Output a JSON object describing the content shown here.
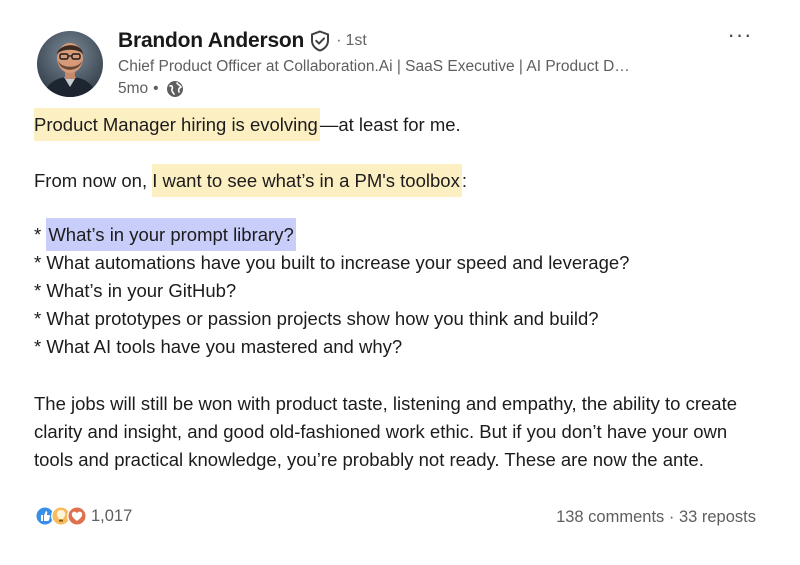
{
  "author": {
    "name": "Brandon Anderson",
    "degree": "1st",
    "headline": "Chief Product Officer at Collaboration.Ai | SaaS Executive | AI Product D…",
    "posted_ago": "5mo",
    "separator": "•"
  },
  "post": {
    "line1_highlight": "Product Manager hiring is evolving",
    "line1_rest": "—at least for me.",
    "line2_prefix": "From now on, ",
    "line2_highlight": "I want to see what’s in a PM's toolbox",
    "line2_suffix": ":",
    "bullets": [
      {
        "star": "* ",
        "text": "What’s in your prompt library?"
      },
      {
        "star": "* ",
        "text": "What automations have you built to increase your speed and leverage?"
      },
      {
        "star": "* ",
        "text": "What’s in your GitHub?"
      },
      {
        "star": "* ",
        "text": "What prototypes or passion projects show how you think and build?"
      },
      {
        "star": "* ",
        "text": "What AI tools have you mastered and why?"
      }
    ],
    "closing": "The jobs will still be won with product taste, listening and empathy, the ability to create clarity and insight, and good old-fashioned work ethic. But if you don’t have your own tools and practical knowledge, you’re probably not ready. These are now the ante."
  },
  "footer": {
    "reaction_count": "1,017",
    "comments": "138 comments",
    "dot": " · ",
    "reposts": "33 reposts",
    "reaction_icons": [
      "like-icon",
      "insightful-icon",
      "love-icon"
    ]
  },
  "menu": {
    "more_label": "···"
  },
  "colors": {
    "highlight_yellow": "#fcefc2",
    "highlight_blue": "#c9cdfa",
    "like_blue": "#378fe9",
    "love_red": "#df704d",
    "insightful_yellow": "#f5bb5c"
  }
}
